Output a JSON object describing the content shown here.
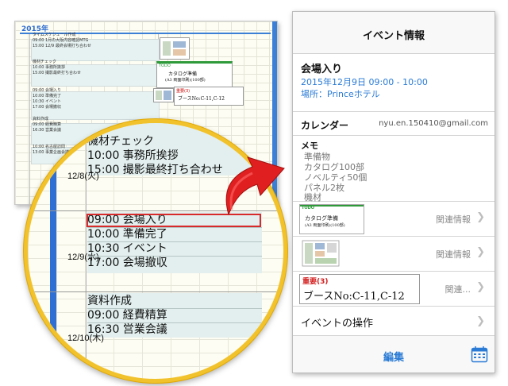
{
  "planner": {
    "year": "2015年",
    "mini_lines": [
      "タイムスケジュール作成",
      "09:00 1月の大阪内容確認MTG",
      "15:00 12/9 最終会場打ち合わせ",
      "機材チェック",
      "10:00 事務所挨拶",
      "15:00 撮影最終打ち合わせ",
      "09:00 会場入り",
      "10:00 準備完了",
      "10:30 イベント",
      "17:00 会場撤収",
      "資料作成",
      "09:00 経費精算",
      "16:30 営業会議",
      "10:00 名古屋訪問",
      "13:00 事業企画会議"
    ],
    "thumb_todo": "TODO",
    "thumb_hand_1": "カタログ準備",
    "thumb_hand_2": "(A3 両面印刷)(100部)",
    "thumb_imp_label": "重要(3)",
    "thumb_imp_text": "ブースNo:C-11,C-12"
  },
  "magnifier": {
    "rows": [
      {
        "date": "",
        "lines": [
          "機材チェック",
          "10:00 事務所挨拶",
          "15:00 撮影最終打ち合わせ"
        ]
      },
      {
        "date": "12/8(火)",
        "lines": []
      },
      {
        "date": "12/9(水)",
        "lines": [
          "09:00 会場入り",
          "10:00 準備完了",
          "10:30 イベント",
          "17:00 会場撤収"
        ]
      },
      {
        "date": "12/10(木)",
        "lines": [
          "資料作成",
          "09:00 経費精算",
          "16:30 営業会議"
        ]
      }
    ]
  },
  "phone": {
    "nav_title": "イベント情報",
    "event": {
      "title": "会場入り",
      "time": "2015年12月9日 09:00 - 10:00",
      "place": "場所：Princeホテル"
    },
    "calendar": {
      "label": "カレンダー",
      "value": "nyu.en.150410@gmail.com"
    },
    "memo": {
      "label": "メモ",
      "lines": [
        "準備物",
        "カタログ100部",
        "ノベルティ50個",
        "パネル2枚",
        "機材"
      ]
    },
    "related": [
      {
        "label": "関連情報",
        "kind": "todo",
        "todo": "TODO",
        "hand_1": "カタログ準備",
        "hand_2": "(A3 両面印刷)(100部)"
      },
      {
        "label": "関連情報",
        "kind": "map"
      },
      {
        "label": "関連...",
        "kind": "important",
        "imp_label": "重要(3)",
        "imp_text": "ブースNo:C-11,C-12"
      }
    ],
    "operations_label": "イベントの操作",
    "edit_label": "編集",
    "colors": {
      "accent": "#2a7bd5",
      "important": "#d42020",
      "todo": "#2e9a3a",
      "highlight": "#d82a2a",
      "magnifier_ring": "#f2c22c"
    }
  }
}
